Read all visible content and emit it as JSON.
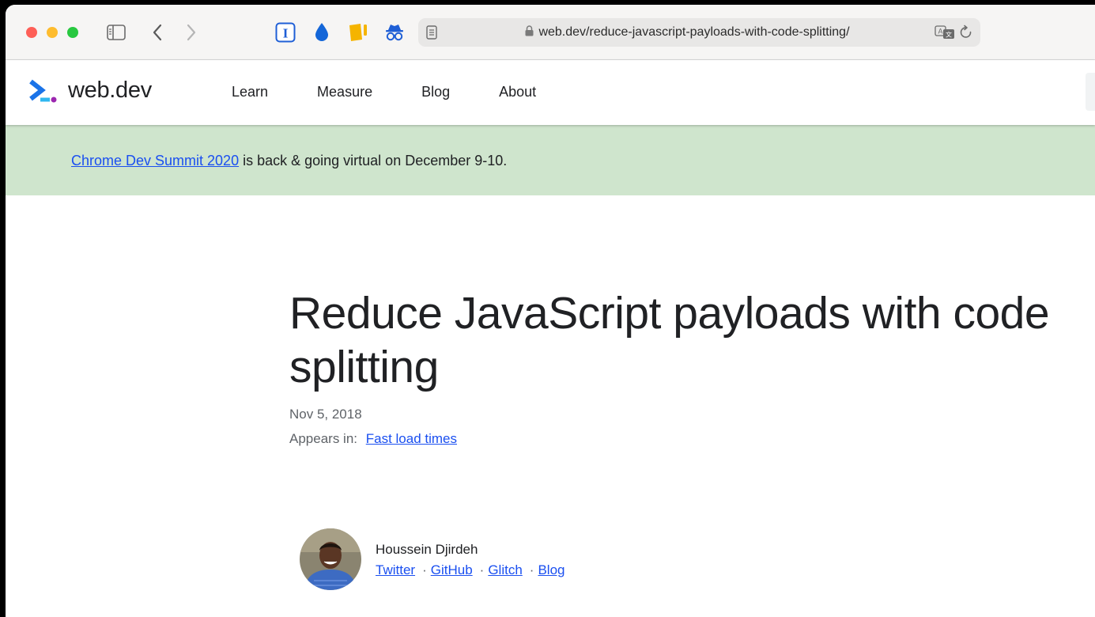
{
  "browser": {
    "url": "web.dev/reduce-javascript-payloads-with-code-splitting/",
    "icons": [
      "sidebar-icon",
      "back-icon",
      "forward-icon",
      "instapaper-icon",
      "drop-icon",
      "notes-icon",
      "spy-icon",
      "reader-icon",
      "lock-icon",
      "translate-icon",
      "reload-icon"
    ]
  },
  "site": {
    "logo_text": "web.dev",
    "nav": [
      "Learn",
      "Measure",
      "Blog",
      "About"
    ]
  },
  "banner": {
    "link": "Chrome Dev Summit 2020",
    "text": " is back & going virtual on December 9-10."
  },
  "article": {
    "title": "Reduce JavaScript payloads with code splitting",
    "date": "Nov 5, 2018",
    "appears_label": "Appears in:",
    "appears_link": "Fast load times"
  },
  "author": {
    "name": "Houssein Djirdeh",
    "links": [
      "Twitter",
      "GitHub",
      "Glitch",
      "Blog"
    ]
  },
  "colors": {
    "accent": "#1a4ff0",
    "banner": "#cfe5cd",
    "logo_blue": "#1a73e8",
    "logo_purple": "#9c27b0"
  }
}
